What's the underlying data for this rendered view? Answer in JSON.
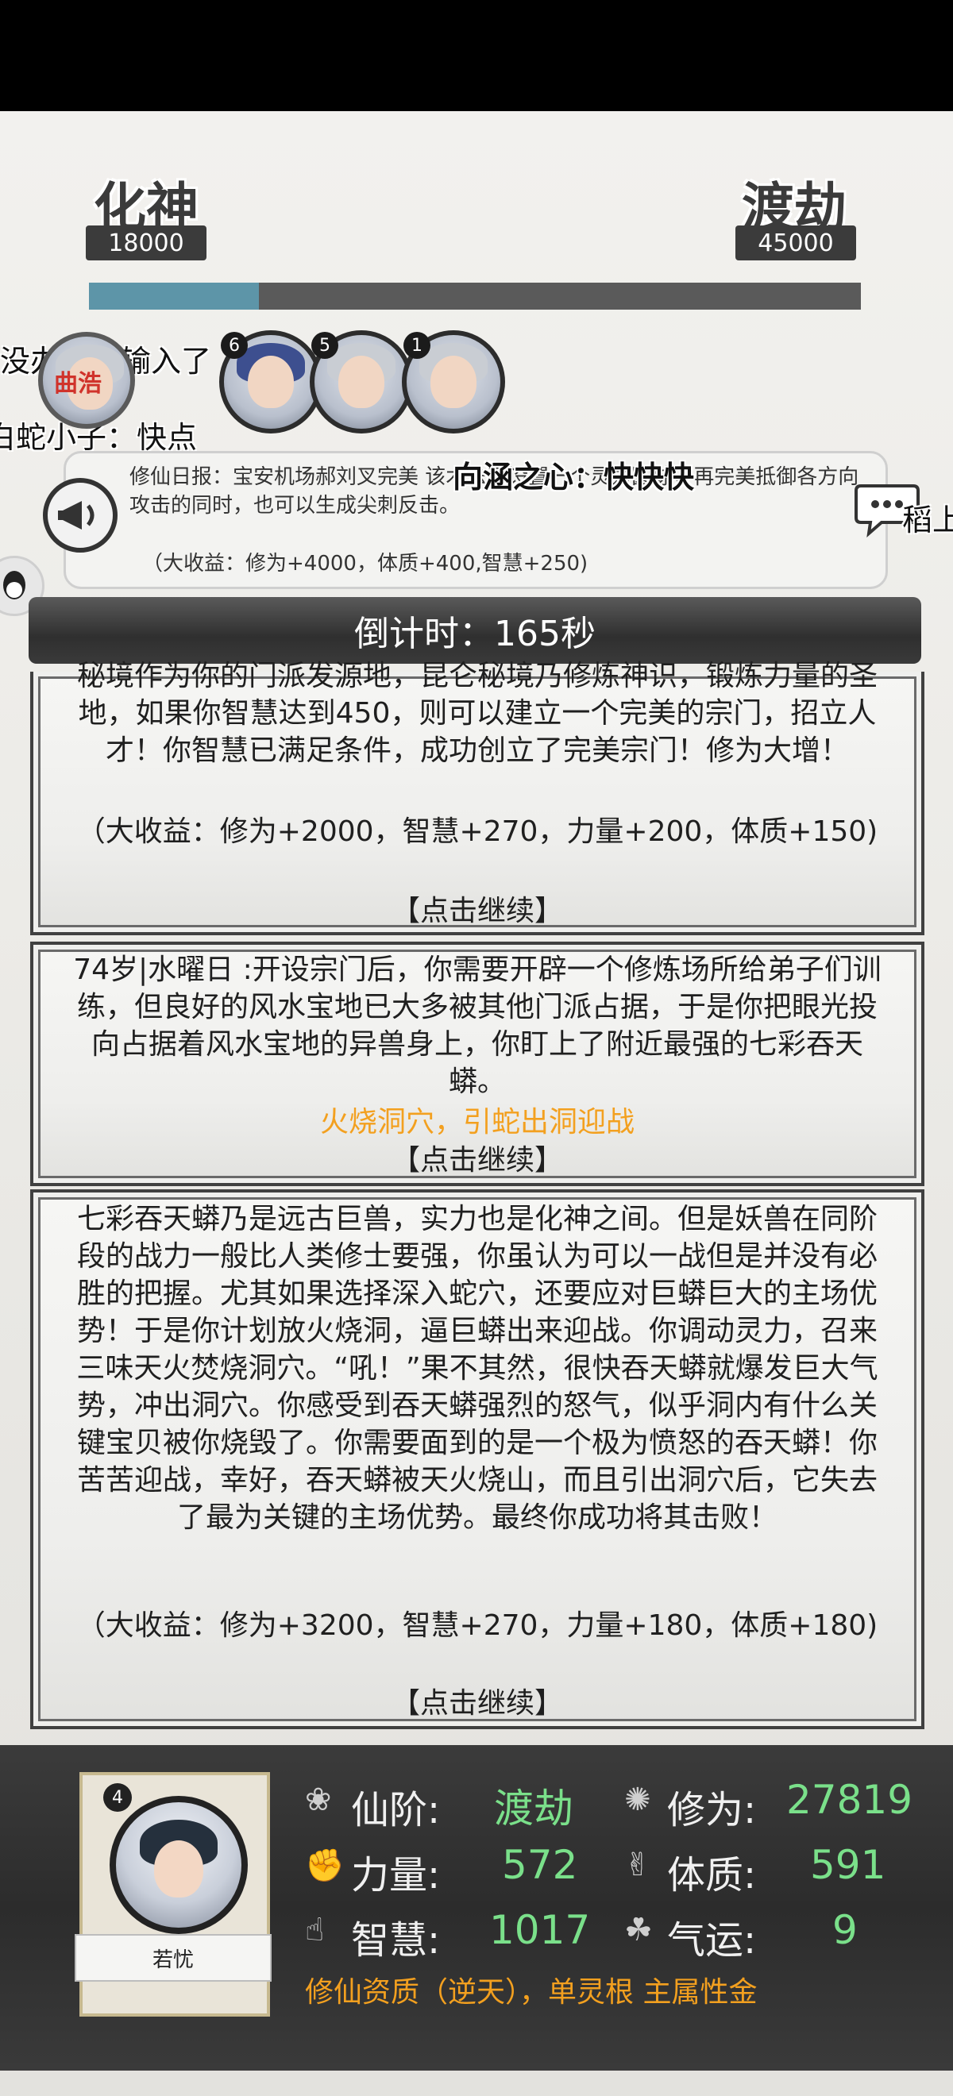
{
  "realm": {
    "current_name": "化神",
    "current_value": "18000",
    "next_name": "渡劫",
    "next_value": "45000",
    "progress_fraction": 0.22
  },
  "chat": {
    "line1": "没办法，输入了",
    "line2": "白蛇小子：快点",
    "danmaku": "向涵之心：快快快",
    "right_snippet": "稻上",
    "avatar_overlay": "曲浩"
  },
  "avatars": [
    {
      "num": "6"
    },
    {
      "num": "5"
    },
    {
      "num": "1"
    }
  ],
  "news": {
    "text": "修仙日报：宝安机场郝刘叉完美                                    该术法可设置一个灵力圆球，再完美抵御各方向攻击的同时，也可以生成尖刺反击。",
    "gain": "（大收益：修为+4000，体质+400,智慧+250)"
  },
  "countdown": "倒计时：165秒",
  "cards": [
    {
      "text": "秘境作为你的门派发源地，昆仑秘境乃修炼神识，锻炼力量的圣地，如果你智慧达到450，则可以建立一个完美的宗门，招立人才！你智慧已满足条件，成功创立了完美宗门！修为大增！",
      "gain": "（大收益：修为+2000，智慧+270，力量+200，体质+150)",
      "continue": "【点击继续】"
    },
    {
      "text": "74岁|水曜日 :开设宗门后，你需要开辟一个修炼场所给弟子们训练，但良好的风水宝地已大多被其他门派占据，于是你把眼光投向占据着风水宝地的异兽身上，你盯上了附近最强的七彩吞天蟒。",
      "choice": "火烧洞穴，引蛇出洞迎战",
      "continue": "【点击继续】"
    },
    {
      "text": "七彩吞天蟒乃是远古巨兽，实力也是化神之间。但是妖兽在同阶段的战力一般比人类修士要强，你虽认为可以一战但是并没有必胜的把握。尤其如果选择深入蛇穴，还要应对巨蟒巨大的主场优势！于是你计划放火烧洞，逼巨蟒出来迎战。你调动灵力，召来三味天火焚烧洞穴。“吼！”果不其然，很快吞天蟒就爆发巨大气势，冲出洞穴。你感受到吞天蟒强烈的怒气，似乎洞内有什么关键宝贝被你烧毁了。你需要面到的是一个极为愤怒的吞天蟒！你苦苦迎战，幸好，吞天蟒被天火烧山，而且引出洞穴后，它失去了最为关键的主场优势。最终你成功将其击败！",
      "gain": "（大收益：修为+3200，智慧+270，力量+180，体质+180)",
      "continue": "【点击继续】"
    }
  ],
  "character": {
    "name": "若忧",
    "badge": "4",
    "stats": {
      "rank_label": "仙阶:",
      "rank_value": "渡劫",
      "cultivation_label": "修为:",
      "cultivation_value": "27819",
      "strength_label": "力量:",
      "strength_value": "572",
      "constitution_label": "体质:",
      "constitution_value": "591",
      "wisdom_label": "智慧:",
      "wisdom_value": "1017",
      "luck_label": "气运:",
      "luck_value": "9"
    },
    "aptitude": "修仙资质（逆天），单灵根 主属性金"
  },
  "colors": {
    "accent_orange": "#f3a01f",
    "stat_green": "#7ae08a",
    "progress_blue": "#5d95a8"
  }
}
